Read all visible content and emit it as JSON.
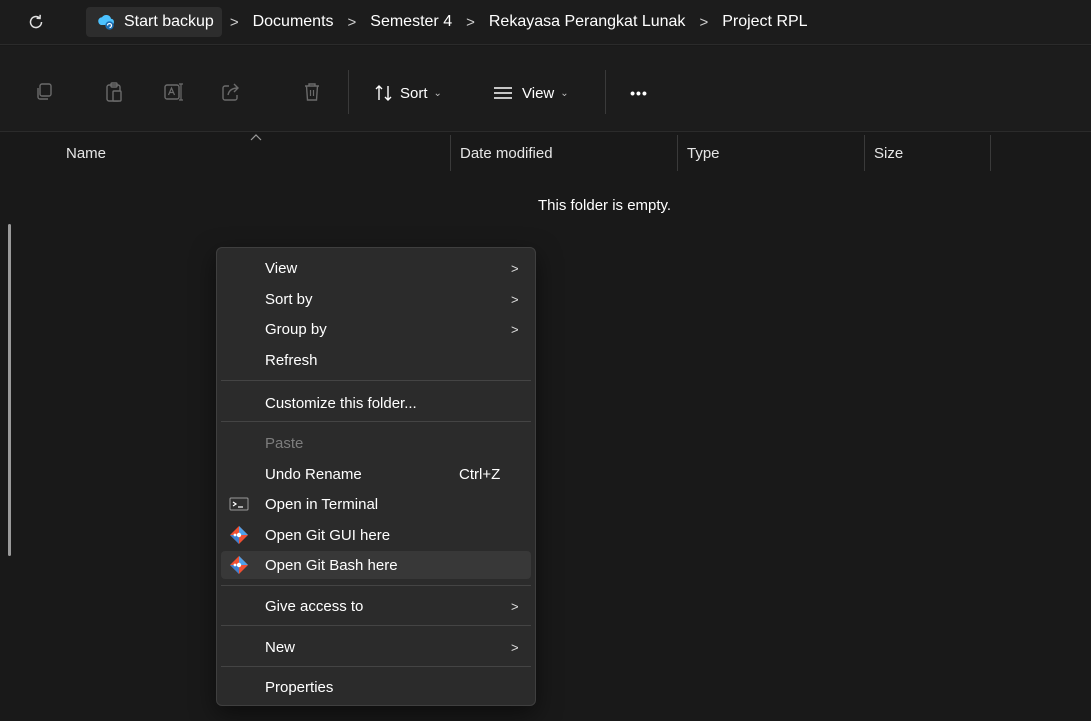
{
  "addressbar": {
    "refresh_icon": "refresh-icon",
    "breadcrumbs": [
      "Start backup",
      "Documents",
      "Semester 4",
      "Rekayasa Perangkat Lunak",
      "Project RPL"
    ],
    "separator": ">"
  },
  "toolbar": {
    "icons": [
      "copy-icon",
      "paste-icon",
      "rename-icon",
      "share-icon",
      "delete-icon"
    ],
    "sort_label": "Sort",
    "view_label": "View",
    "more_label": "•••"
  },
  "columns": [
    "Name",
    "Date modified",
    "Type",
    "Size"
  ],
  "empty_message": "This folder is empty.",
  "context_menu": {
    "items": [
      {
        "label": "View",
        "submenu": true
      },
      {
        "label": "Sort by",
        "submenu": true
      },
      {
        "label": "Group by",
        "submenu": true
      },
      {
        "label": "Refresh"
      },
      {
        "label": "Customize this folder..."
      },
      {
        "label": "Paste",
        "disabled": true
      },
      {
        "label": "Undo Rename",
        "accelerator": "Ctrl+Z"
      },
      {
        "label": "Open in Terminal",
        "icon": "terminal-icon"
      },
      {
        "label": "Open Git GUI here",
        "icon": "git-icon"
      },
      {
        "label": "Open Git Bash here",
        "icon": "git-icon",
        "hovered": true
      },
      {
        "label": "Give access to",
        "submenu": true
      },
      {
        "label": "New",
        "submenu": true
      },
      {
        "label": "Properties"
      }
    ],
    "submenu_arrow": ">"
  },
  "colors": {
    "background": "#191919",
    "menu_background": "#2b2b2b",
    "accent_cloud": "#4cc2ff",
    "git_orange": "#f05033"
  }
}
